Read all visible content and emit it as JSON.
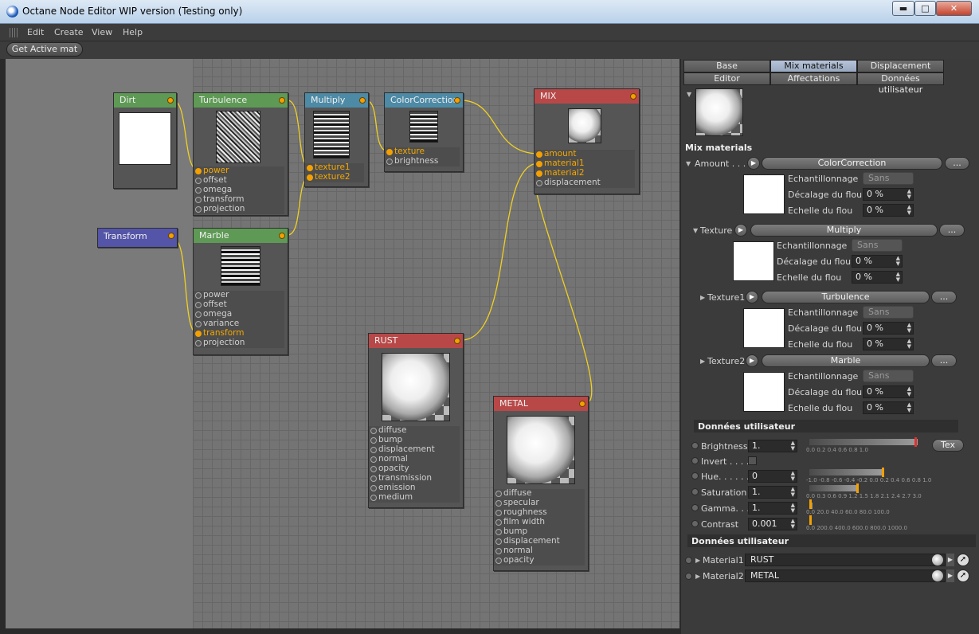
{
  "window": {
    "title": "Octane Node Editor WIP version (Testing only)",
    "minimize": "▬",
    "maximize": "□",
    "close": "✕"
  },
  "menu": [
    "Edit",
    "Create",
    "View",
    "Help"
  ],
  "toolbar": {
    "get_active": "Get Active mat"
  },
  "nodes": {
    "dirt": {
      "title": "Dirt"
    },
    "turbulence": {
      "title": "Turbulence",
      "ports": [
        "power",
        "offset",
        "omega",
        "transform",
        "projection"
      ]
    },
    "multiply": {
      "title": "Multiply",
      "ports": [
        "texture1",
        "texture2"
      ]
    },
    "colorcorrection": {
      "title": "ColorCorrection",
      "ports": [
        "texture",
        "brightness"
      ]
    },
    "mix": {
      "title": "MIX",
      "ports": [
        "amount",
        "material1",
        "material2",
        "displacement"
      ]
    },
    "transform": {
      "title": "Transform"
    },
    "marble": {
      "title": "Marble",
      "ports": [
        "power",
        "offset",
        "omega",
        "variance",
        "transform",
        "projection"
      ]
    },
    "rust": {
      "title": "RUST",
      "ports": [
        "diffuse",
        "bump",
        "displacement",
        "normal",
        "opacity",
        "transmission",
        "emission",
        "medium"
      ]
    },
    "metal": {
      "title": "METAL",
      "ports": [
        "diffuse",
        "specular",
        "roughness",
        "film width",
        "bump",
        "displacement",
        "normal",
        "opacity"
      ]
    }
  },
  "panel": {
    "tabs_row1": [
      "Base",
      "Mix materials",
      "Displacement"
    ],
    "tabs_row2": [
      "Editor",
      "Affectations",
      "Données utilisateur"
    ],
    "section_title": "Mix materials",
    "amount": {
      "label": "Amount . . . .",
      "link": "ColorCorrection",
      "more": "...",
      "sampling_label": "Echantillonnage",
      "sampling_value": "Sans",
      "blur_offset_label": "Décalage du flou",
      "blur_offset": "0 %",
      "blur_scale_label": "Echelle du flou",
      "blur_scale": "0 %"
    },
    "texture": {
      "label": "Texture",
      "link": "Multiply",
      "more": "...",
      "sampling_label": "Echantillonnage",
      "sampling_value": "Sans",
      "blur_offset_label": "Décalage du flou",
      "blur_offset": "0 %",
      "blur_scale_label": "Echelle du flou",
      "blur_scale": "0 %"
    },
    "texture1": {
      "label": "Texture1",
      "link": "Turbulence",
      "more": "...",
      "sampling_label": "Echantillonnage",
      "sampling_value": "Sans",
      "blur_offset_label": "Décalage du flou",
      "blur_offset": "0 %",
      "blur_scale_label": "Echelle du flou",
      "blur_scale": "0 %"
    },
    "texture2": {
      "label": "Texture2",
      "link": "Marble",
      "more": "...",
      "sampling_label": "Echantillonnage",
      "sampling_value": "Sans",
      "blur_offset_label": "Décalage du flou",
      "blur_offset": "0 %",
      "blur_scale_label": "Echelle du flou",
      "blur_scale": "0 %"
    },
    "user_data_title": "Données utilisateur",
    "brightness": {
      "label": "Brightness",
      "value": "1.",
      "button": "Tex",
      "scale": "0.0 0.2 0.4 0.6 0.8 1.0"
    },
    "invert": {
      "label": "Invert . . . ."
    },
    "hue": {
      "label": "Hue. . . . . .",
      "value": "0",
      "scale": "-1.0 -0.8 -0.6 -0.4 -0.2 0.0 0.2 0.4 0.6 0.8 1.0"
    },
    "saturation": {
      "label": "Saturation",
      "value": "1.",
      "scale": "0.0 0.3 0.6 0.9 1.2 1.5 1.8 2.1 2.4 2.7 3.0"
    },
    "gamma": {
      "label": "Gamma. . . .",
      "value": "1.",
      "scale": "0.0 20.0 40.0 60.0 80.0 100.0"
    },
    "contrast": {
      "label": "Contrast",
      "value": "0.001",
      "scale": "0.0 200.0 400.0 600.0 800.0 1000.0"
    },
    "user_data_title2": "Données utilisateur",
    "material1": {
      "label": "Material1",
      "value": "RUST"
    },
    "material2": {
      "label": "Material2",
      "value": "METAL"
    }
  }
}
